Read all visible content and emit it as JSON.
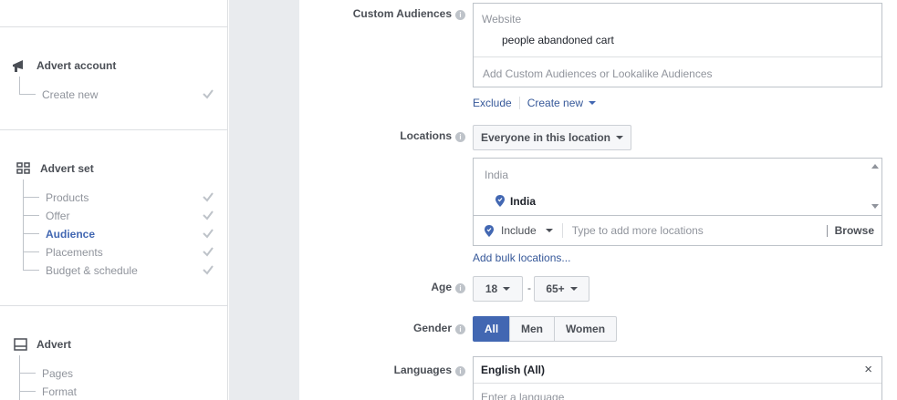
{
  "sidebar": {
    "advert_account": {
      "title": "Advert account",
      "items": [
        {
          "label": "Create new",
          "checked": true
        }
      ]
    },
    "advert_set": {
      "title": "Advert set",
      "items": [
        {
          "label": "Products",
          "checked": true
        },
        {
          "label": "Offer",
          "checked": true
        },
        {
          "label": "Audience",
          "checked": true,
          "active": true
        },
        {
          "label": "Placements",
          "checked": true
        },
        {
          "label": "Budget & schedule",
          "checked": true
        }
      ]
    },
    "advert": {
      "title": "Advert",
      "items": [
        {
          "label": "Pages"
        },
        {
          "label": "Format"
        }
      ]
    }
  },
  "form": {
    "custom_audiences": {
      "label": "Custom Audiences",
      "group_label": "Website",
      "selected": "people abandoned cart",
      "placeholder": "Add Custom Audiences or Lookalike Audiences",
      "exclude": "Exclude",
      "create_new": "Create new"
    },
    "locations": {
      "label": "Locations",
      "dropdown": "Everyone in this location",
      "group_label": "India",
      "selected": "India",
      "include": "Include",
      "placeholder": "Type to add more locations",
      "browse": "Browse",
      "bulk": "Add bulk locations..."
    },
    "age": {
      "label": "Age",
      "min": "18",
      "separator": "-",
      "max": "65+"
    },
    "gender": {
      "label": "Gender",
      "options": [
        "All",
        "Men",
        "Women"
      ],
      "selected": "All"
    },
    "languages": {
      "label": "Languages",
      "selected": "English (All)",
      "remove": "×",
      "placeholder": "Enter a language"
    }
  },
  "colors": {
    "accent": "#4267b2",
    "link": "#365899",
    "gutter": "#e9ebee"
  }
}
